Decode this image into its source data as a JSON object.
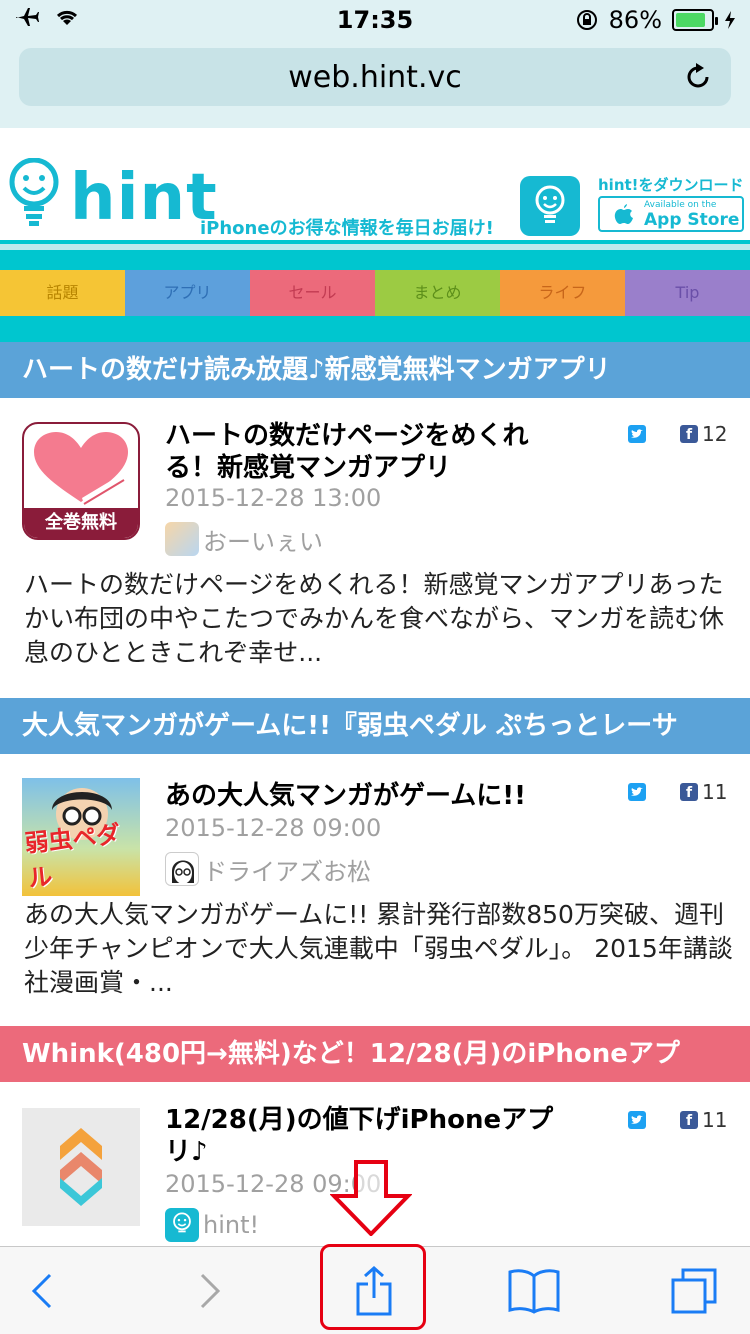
{
  "status_bar": {
    "time": "17:35",
    "battery_percent": "86%",
    "battery_level": 0.86
  },
  "browser": {
    "url": "web.hint.vc"
  },
  "site": {
    "logo_text": "hint",
    "tagline": "iPhoneのお得な情報を毎日お届け!",
    "download_text": "hint!をダウンロード",
    "appstore_small": "Available on the",
    "appstore_big": "App Store"
  },
  "nav": {
    "tabs": [
      {
        "label": "話題",
        "color": "#f5c535",
        "text": "#b88500"
      },
      {
        "label": "アプリ",
        "color": "#5da0dc",
        "text": "#2f6fb5"
      },
      {
        "label": "セール",
        "color": "#ec6a7b",
        "text": "#c23b52"
      },
      {
        "label": "まとめ",
        "color": "#9ccb43",
        "text": "#5d8f1a"
      },
      {
        "label": "ライフ",
        "color": "#f59a3c",
        "text": "#c8661a"
      },
      {
        "label": "Tip",
        "color": "#9a7fcb",
        "text": "#6a4fa8"
      }
    ]
  },
  "articles": [
    {
      "section_title": "ハートの数だけ読み放題♪新感覚無料マンガアプリ",
      "section_color": "#5ba3d8",
      "title": "ハートの数だけページをめくれる！新感覚マンガアプリ",
      "date": "2015-12-28 13:00",
      "author": "おーいぇい",
      "fb_count": "12",
      "thumb_label": "全巻無料",
      "excerpt": "ハートの数だけページをめくれる！新感覚マンガアプリあったかい布団の中やこたつでみかんを食べながら、マンガを読む休息のひとときこれぞ幸せ..."
    },
    {
      "section_title": "大人気マンガがゲームに!!『弱虫ペダル ぷちっとレーサ",
      "section_color": "#5ba3d8",
      "title": "あの大人気マンガがゲームに!!",
      "date": "2015-12-28 09:00",
      "author": "ドライアズお松",
      "fb_count": "11",
      "thumb_label": "弱虫ペダル",
      "excerpt": "あの大人気マンガがゲームに!! 累計発行部数850万突破、週刊少年チャンピオンで大人気連載中「弱虫ペダル」。 2015年講談社漫画賞・..."
    },
    {
      "section_title": "Whink(480円→無料)など！12/28(月)のiPhoneアプ",
      "section_color": "#ec6a7b",
      "title": "12/28(月)の値下げiPhoneアプリ♪",
      "date": "2015-12-28 09:00",
      "author": "hint!",
      "fb_count": "11"
    }
  ],
  "toolbar": {
    "buttons": [
      "back",
      "forward",
      "share",
      "bookmarks",
      "tabs"
    ]
  },
  "annotation": {
    "color": "#e60012"
  }
}
